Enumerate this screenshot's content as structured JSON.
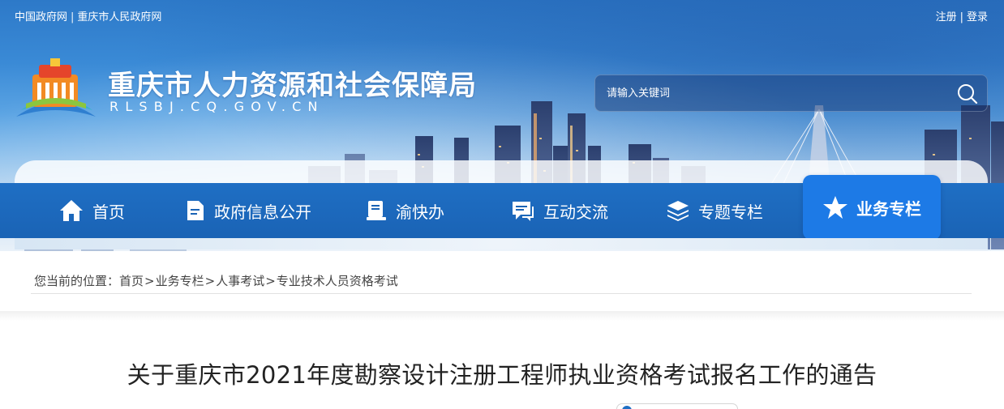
{
  "top_links": {
    "link1": "中国政府网",
    "separator": "|",
    "link2": "重庆市人民政府网"
  },
  "user_links": {
    "register": "注册",
    "separator": "|",
    "login": "登录"
  },
  "site": {
    "title": "重庆市人力资源和社会保障局",
    "domain": "RLSBJ.CQ.GOV.CN"
  },
  "search": {
    "placeholder": "请输入关键词",
    "icon": "search-icon"
  },
  "nav": {
    "items": [
      {
        "label": "首页",
        "icon": "home-icon"
      },
      {
        "label": "政府信息公开",
        "icon": "document-icon"
      },
      {
        "label": "渝快办",
        "icon": "service-icon"
      },
      {
        "label": "互动交流",
        "icon": "chat-icon"
      },
      {
        "label": "专题专栏",
        "icon": "layers-icon"
      },
      {
        "label": "业务专栏",
        "icon": "star-icon",
        "active": true
      }
    ]
  },
  "breadcrumb": {
    "prefix": "您当前的位置：",
    "items": [
      "首页",
      "业务专栏",
      "人事考试",
      "专业技术人员资格考试"
    ],
    "separator": ">"
  },
  "article": {
    "title": "关于重庆市2021年度勘察设计注册工程师执业资格考试报名工作的通告"
  },
  "colors": {
    "nav_bg": "#1a63b5",
    "nav_active": "#1d7ae6",
    "text": "#222222"
  }
}
